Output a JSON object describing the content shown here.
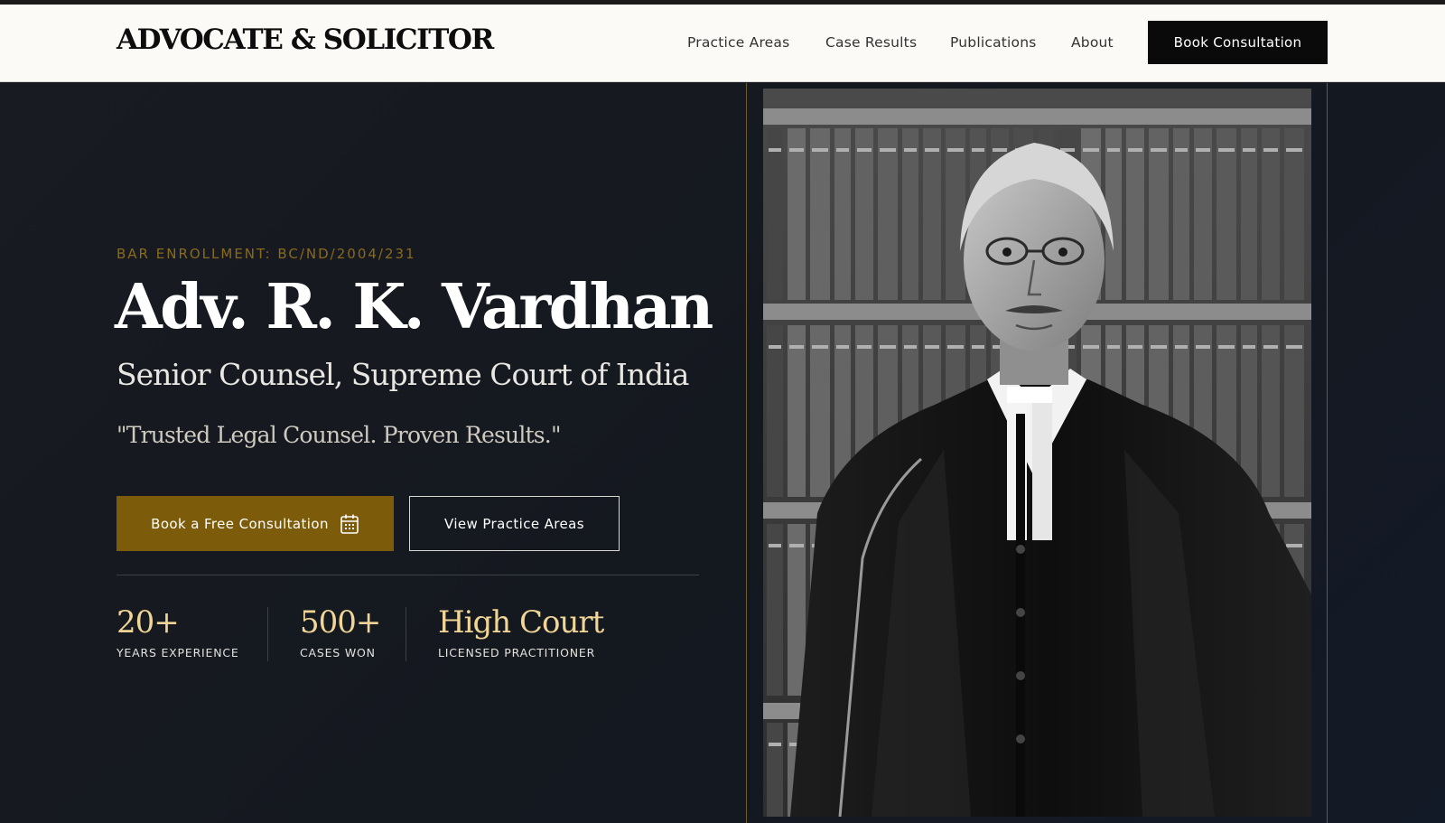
{
  "header": {
    "logo": "ADVOCATE & SOLICITOR",
    "nav": [
      "Practice Areas",
      "Case Results",
      "Publications",
      "About"
    ],
    "cta": "Book Consultation"
  },
  "hero": {
    "eyebrow": "BAR ENROLLMENT: BC/ND/2004/231",
    "name": "Adv. R. K. Vardhan",
    "subtitle": "Senior Counsel, Supreme Court of India",
    "tagline": "\"Trusted Legal Counsel. Proven Results.\"",
    "primary_button": "Book a Free Consultation",
    "primary_button_icon": "calendar-icon",
    "secondary_button": "View Practice Areas",
    "stats": [
      {
        "value": "20+",
        "label": "YEARS EXPERIENCE"
      },
      {
        "value": "500+",
        "label": "CASES WON"
      },
      {
        "value": "High Court",
        "label": "LICENSED PRACTITIONER"
      }
    ]
  },
  "portrait": {
    "subject": "advocate-portrait-black-and-white"
  },
  "colors": {
    "accent_gold": "#7c5c0b",
    "stat_gold": "#f0d596",
    "eyebrow_gold": "#8a6a1c",
    "hero_bg": "#14171d",
    "header_bg": "#fbfaf7"
  }
}
